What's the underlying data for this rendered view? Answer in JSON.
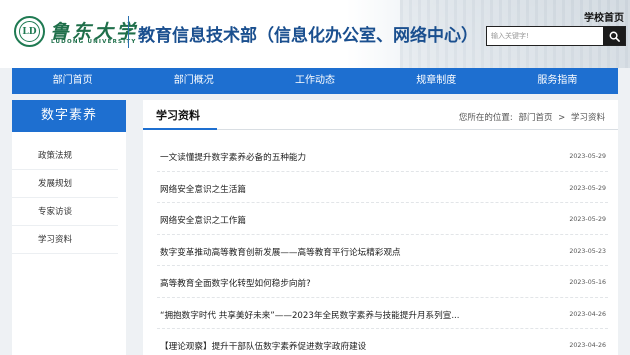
{
  "header": {
    "logo_name": "鲁东大学",
    "logo_seal": "LD",
    "logo_subtitle": "LUDONG UNIVERSITY",
    "site_title": "教育信息技术部（信息化办公室、网络中心）",
    "school_home": "学校首页",
    "search": {
      "placeholder": "输入关键字!",
      "icon": "search-icon"
    }
  },
  "nav": {
    "items": [
      "部门首页",
      "部门概况",
      "工作动态",
      "规章制度",
      "服务指南"
    ]
  },
  "sidebar": {
    "title": "数字素养",
    "items": [
      "政策法规",
      "发展规划",
      "专家访谈",
      "学习资料"
    ]
  },
  "main": {
    "tab": "学习资料",
    "breadcrumb": {
      "prefix": "您所在的位置:",
      "home": "部门首页",
      "separator": ">",
      "current": "学习资料"
    },
    "articles": [
      {
        "title": "一文读懂提升数字素养必备的五种能力",
        "date": "2023-05-29"
      },
      {
        "title": "网络安全意识之生活篇",
        "date": "2023-05-29"
      },
      {
        "title": "网络安全意识之工作篇",
        "date": "2023-05-29"
      },
      {
        "title": "数字变革推动高等教育创新发展——高等教育平行论坛精彩观点",
        "date": "2023-05-23"
      },
      {
        "title": "高等教育全面数字化转型如何稳步向前?",
        "date": "2023-05-16"
      },
      {
        "title": "“拥抱数字时代 共享美好未来”——2023年全民数字素养与技能提升月系列宣...",
        "date": "2023-04-26"
      },
      {
        "title": "【理论观察】提升干部队伍数字素养促进数字政府建设",
        "date": "2023-04-26"
      }
    ]
  },
  "colors": {
    "primary": "#1e6fd0",
    "title": "#1a4f8f",
    "logo": "#1f6f4a"
  }
}
